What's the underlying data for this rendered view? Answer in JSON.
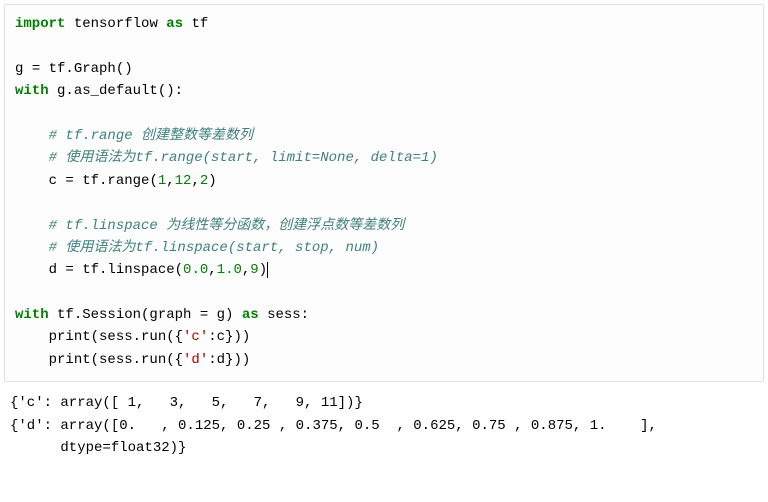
{
  "code": {
    "l1": {
      "kw1": "import",
      "sp1": " ",
      "nm1": "tensorflow ",
      "kw2": "as",
      "sp2": " ",
      "nm2": "tf"
    },
    "l2": "",
    "l3": {
      "nm1": "g ",
      "op": "=",
      "nm2": " tf.Graph()"
    },
    "l4": {
      "kw1": "with",
      "nm1": " g.as_default():"
    },
    "l5": "",
    "l6": {
      "pad": "    ",
      "c": "# tf.range 创建整数等差数列"
    },
    "l7": {
      "pad": "    ",
      "c": "# 使用语法为tf.range(start, limit=None, delta=1)"
    },
    "l8": {
      "pad": "    ",
      "lhs": "c ",
      "op": "=",
      "mid": " tf.range(",
      "n1": "1",
      "c1": ",",
      "n2": "12",
      "c2": ",",
      "n3": "2",
      "rp": ")"
    },
    "l9": "",
    "l10": {
      "pad": "    ",
      "c": "# tf.linspace 为线性等分函数，创建浮点数等差数列"
    },
    "l11": {
      "pad": "    ",
      "c": "# 使用语法为tf.linspace(start, stop, num)"
    },
    "l12": {
      "pad": "    ",
      "lhs": "d ",
      "op": "=",
      "mid": " tf.linspace(",
      "n1": "0.0",
      "c1": ",",
      "n2": "1.0",
      "c2": ",",
      "n3": "9",
      "rp": ")"
    },
    "l13": "",
    "l14": {
      "kw1": "with",
      "nm1": " tf.Session(graph ",
      "op": "=",
      "nm2": " g) ",
      "kw2": "as",
      "nm3": " sess:"
    },
    "l15": {
      "pad": "    ",
      "nm1": "print(sess.run({",
      "s": "'c'",
      "nm2": ":c}))"
    },
    "l16": {
      "pad": "    ",
      "nm1": "print(sess.run({",
      "s": "'d'",
      "nm2": ":d}))"
    }
  },
  "output": {
    "o1": "{'c': array([ 1,   3,   5,   7,   9, 11])}",
    "o2": "{'d': array([0.   , 0.125, 0.25 , 0.375, 0.5  , 0.625, 0.75 , 0.875, 1.    ],",
    "o3": "      dtype=float32)}"
  }
}
